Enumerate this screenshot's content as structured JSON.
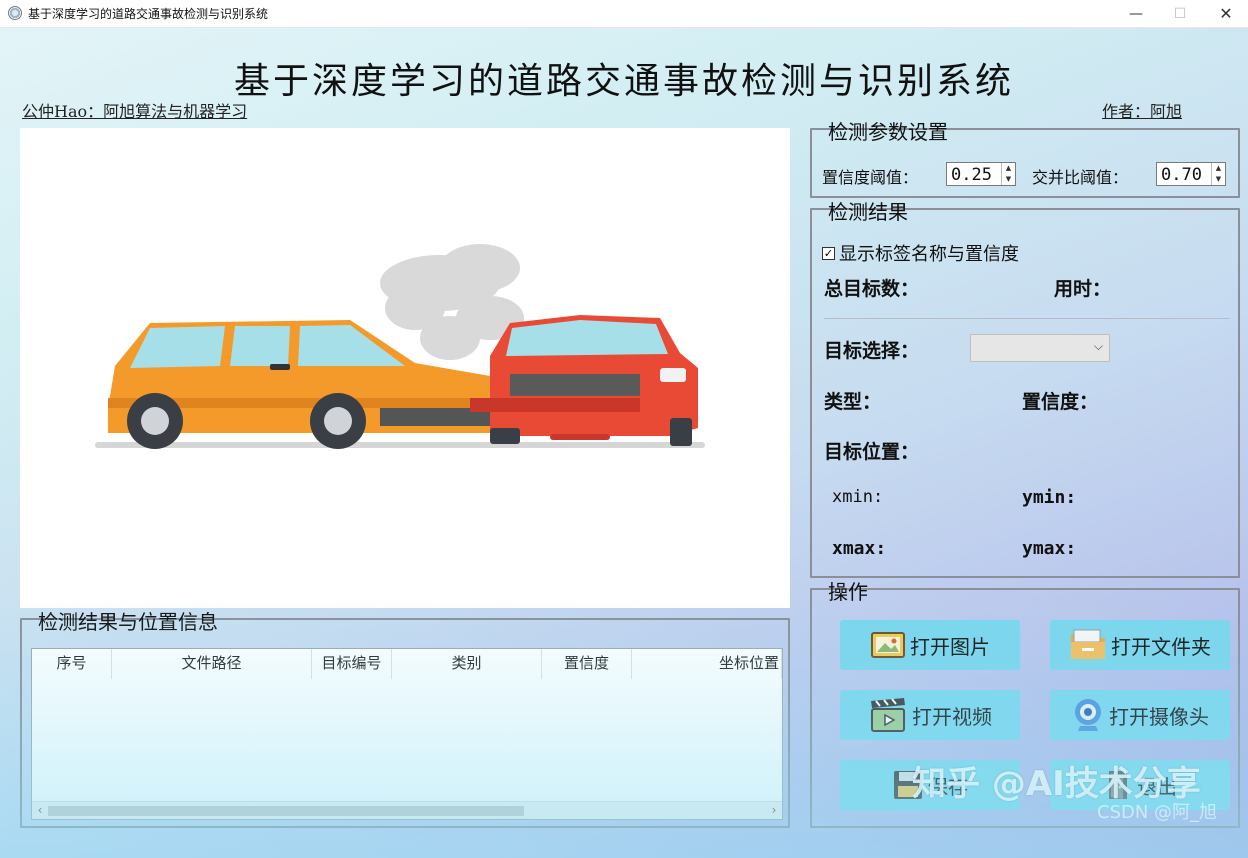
{
  "window": {
    "title": "基于深度学习的道路交通事故检测与识别系统",
    "min": "—",
    "max": "☐",
    "close": "✕"
  },
  "header": {
    "title": "基于深度学习的道路交通事故检测与识别系统",
    "left_text": "公仲Hao：阿旭算法与机器学习",
    "right_text": "作者：阿旭"
  },
  "results_table": {
    "legend": "检测结果与位置信息",
    "columns": [
      "序号",
      "文件路径",
      "目标编号",
      "类别",
      "置信度",
      "坐标位置"
    ],
    "rows": [],
    "scroll_left": "‹",
    "scroll_right": "›"
  },
  "params": {
    "legend": "检测参数设置",
    "conf_label": "置信度阈值：",
    "conf_value": "0.25",
    "iou_label": "交并比阈值：",
    "iou_value": "0.70"
  },
  "detect": {
    "legend": "检测结果",
    "show_labels": "显示标签名称与置信度",
    "show_labels_checked": true,
    "total_label": "总目标数：",
    "time_label": "用时：",
    "target_select_label": "目标选择：",
    "type_label": "类型：",
    "conf_label": "置信度：",
    "position_label": "目标位置：",
    "xmin": "xmin:",
    "ymin": "ymin:",
    "xmax": "xmax:",
    "ymax": "ymax:"
  },
  "ops": {
    "legend": "操作",
    "open_image": "打开图片",
    "open_folder": "打开文件夹",
    "open_video": "打开视频",
    "open_camera": "打开摄像头",
    "save": "保存",
    "exit": "退出"
  },
  "watermark": {
    "main": "知乎 @AI技术分享",
    "sub": "CSDN @阿_旭"
  },
  "colors": {
    "button": "#7ad5ec",
    "car_orange": "#f39a2b",
    "car_red": "#e84a36"
  }
}
